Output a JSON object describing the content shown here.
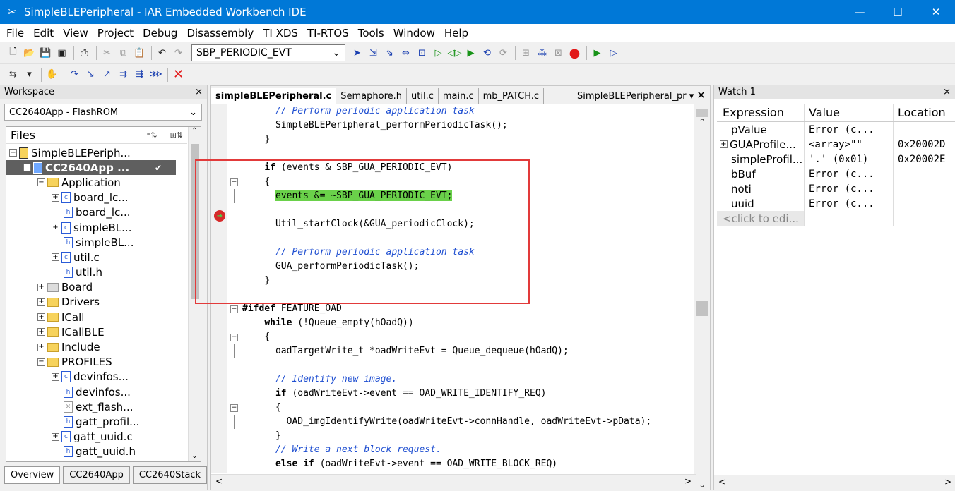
{
  "window": {
    "title": "SimpleBLEPeripheral - IAR Embedded Workbench IDE"
  },
  "menu": [
    "File",
    "Edit",
    "View",
    "Project",
    "Debug",
    "Disassembly",
    "TI XDS",
    "TI-RTOS",
    "Tools",
    "Window",
    "Help"
  ],
  "toolbar": {
    "symbol_combo": "SBP_PERIODIC_EVT"
  },
  "workspace": {
    "title": "Workspace",
    "config": "CC2640App - FlashROM",
    "files_header": "Files",
    "tree": [
      {
        "label": "SimpleBLEPeriph...",
        "depth": 0,
        "expander": "−",
        "icon": "project"
      },
      {
        "label": "CC2640App ...",
        "depth": 1,
        "expander": "−",
        "icon": "app",
        "selected": true
      },
      {
        "label": "Application",
        "depth": 2,
        "expander": "−",
        "icon": "folder"
      },
      {
        "label": "board_lc...",
        "depth": 3,
        "expander": "+",
        "icon": "c"
      },
      {
        "label": "board_lc...",
        "depth": 3,
        "expander": "",
        "icon": "h"
      },
      {
        "label": "simpleBL...",
        "depth": 3,
        "expander": "+",
        "icon": "c"
      },
      {
        "label": "simpleBL...",
        "depth": 3,
        "expander": "",
        "icon": "h"
      },
      {
        "label": "util.c",
        "depth": 3,
        "expander": "+",
        "icon": "c"
      },
      {
        "label": "util.h",
        "depth": 3,
        "expander": "",
        "icon": "h"
      },
      {
        "label": "Board",
        "depth": 2,
        "expander": "+",
        "icon": "board"
      },
      {
        "label": "Drivers",
        "depth": 2,
        "expander": "+",
        "icon": "folder"
      },
      {
        "label": "ICall",
        "depth": 2,
        "expander": "+",
        "icon": "folder"
      },
      {
        "label": "ICallBLE",
        "depth": 2,
        "expander": "+",
        "icon": "folder"
      },
      {
        "label": "Include",
        "depth": 2,
        "expander": "+",
        "icon": "folder"
      },
      {
        "label": "PROFILES",
        "depth": 2,
        "expander": "−",
        "icon": "folder"
      },
      {
        "label": "devinfos...",
        "depth": 3,
        "expander": "+",
        "icon": "c"
      },
      {
        "label": "devinfos...",
        "depth": 3,
        "expander": "",
        "icon": "h"
      },
      {
        "label": "ext_flash...",
        "depth": 3,
        "expander": "",
        "icon": "x"
      },
      {
        "label": "gatt_profil...",
        "depth": 3,
        "expander": "",
        "icon": "h"
      },
      {
        "label": "gatt_uuid.c",
        "depth": 3,
        "expander": "+",
        "icon": "c"
      },
      {
        "label": "gatt_uuid.h",
        "depth": 3,
        "expander": "",
        "icon": "h"
      }
    ],
    "tabs": [
      "Overview",
      "CC2640App",
      "CC2640Stack"
    ]
  },
  "editor": {
    "tabs": [
      "simpleBLEPeripheral.c",
      "Semaphore.h",
      "util.c",
      "main.c",
      "mb_PATCH.c"
    ],
    "right_label": "SimpleBLEPeripheral_pr",
    "lines": [
      {
        "indent": "      ",
        "text": "// Perform periodic application task",
        "cls": "cm"
      },
      {
        "indent": "      ",
        "text": "SimpleBLEPeripheral_performPeriodicTask();",
        "cls": ""
      },
      {
        "indent": "    ",
        "text": "}",
        "cls": ""
      },
      {
        "indent": "",
        "text": "",
        "cls": ""
      },
      {
        "indent": "    ",
        "text": "if (events & SBP_GUA_PERIODIC_EVT)",
        "cls": "kwif"
      },
      {
        "indent": "    ",
        "text": "{",
        "cls": ""
      },
      {
        "indent": "      ",
        "text": "events &= ~SBP_GUA_PERIODIC_EVT;",
        "cls": "hl"
      },
      {
        "indent": "",
        "text": "",
        "cls": ""
      },
      {
        "indent": "      ",
        "text": "Util_startClock(&GUA_periodicClock);",
        "cls": ""
      },
      {
        "indent": "",
        "text": "",
        "cls": ""
      },
      {
        "indent": "      ",
        "text": "// Perform periodic application task",
        "cls": "cm"
      },
      {
        "indent": "      ",
        "text": "GUA_performPeriodicTask();",
        "cls": ""
      },
      {
        "indent": "    ",
        "text": "}",
        "cls": ""
      },
      {
        "indent": "",
        "text": "",
        "cls": ""
      },
      {
        "indent": "",
        "text": "#ifdef FEATURE_OAD",
        "cls": ""
      },
      {
        "indent": "    ",
        "text": "while (!Queue_empty(hOadQ))",
        "cls": ""
      },
      {
        "indent": "    ",
        "text": "{",
        "cls": ""
      },
      {
        "indent": "      ",
        "text": "oadTargetWrite_t *oadWriteEvt = Queue_dequeue(hOadQ);",
        "cls": ""
      },
      {
        "indent": "",
        "text": "",
        "cls": ""
      },
      {
        "indent": "      ",
        "text": "// Identify new image.",
        "cls": "cm"
      },
      {
        "indent": "      ",
        "text": "if (oadWriteEvt->event == OAD_WRITE_IDENTIFY_REQ)",
        "cls": ""
      },
      {
        "indent": "      ",
        "text": "{",
        "cls": ""
      },
      {
        "indent": "        ",
        "text": "OAD_imgIdentifyWrite(oadWriteEvt->connHandle, oadWriteEvt->pData);",
        "cls": ""
      },
      {
        "indent": "      ",
        "text": "}",
        "cls": ""
      },
      {
        "indent": "      ",
        "text": "// Write a next block request.",
        "cls": "cm"
      },
      {
        "indent": "      ",
        "text": "else if (oadWriteEvt->event == OAD_WRITE_BLOCK_REQ)",
        "cls": ""
      }
    ]
  },
  "watch": {
    "title": "Watch 1",
    "columns": [
      "Expression",
      "Value",
      "Location"
    ],
    "rows": [
      {
        "expr": "pValue",
        "value": "Error (c...",
        "loc": "",
        "expander": false
      },
      {
        "expr": "GUAProfile...",
        "value": "<array>\"\"",
        "loc": "0x20002D",
        "expander": true
      },
      {
        "expr": "simpleProfil...",
        "value": "'.' (0x01)",
        "loc": "0x20002E",
        "expander": false
      },
      {
        "expr": "bBuf",
        "value": "Error (c...",
        "loc": "",
        "expander": false
      },
      {
        "expr": "noti",
        "value": "Error (c...",
        "loc": "",
        "expander": false
      },
      {
        "expr": "uuid",
        "value": "Error (c...",
        "loc": "",
        "expander": false
      }
    ],
    "edit_placeholder": "<click to edi..."
  }
}
